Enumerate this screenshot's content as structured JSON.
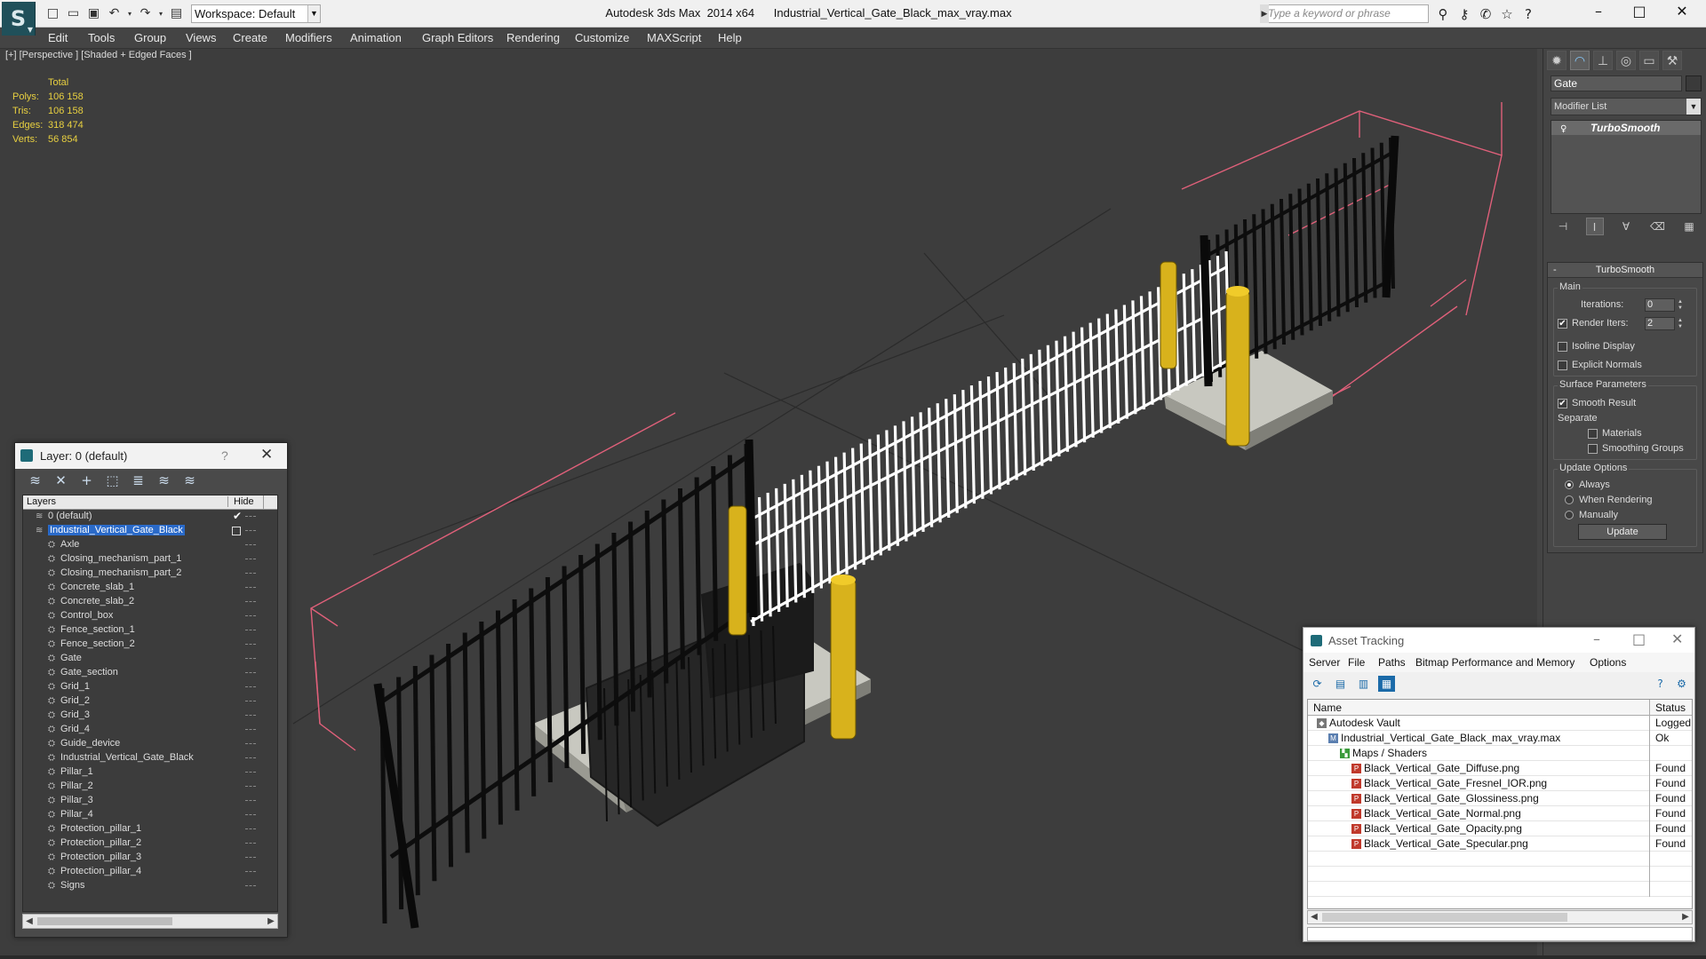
{
  "app": {
    "title": "Autodesk 3ds Max  2014 x64",
    "filename": "Industrial_Vertical_Gate_Black_max_vray.max",
    "workspace": "Workspace: Default",
    "search_placeholder": "Type a keyword or phrase"
  },
  "menu": [
    "Edit",
    "Tools",
    "Group",
    "Views",
    "Create",
    "Modifiers",
    "Animation",
    "Graph Editors",
    "Rendering",
    "Customize",
    "MAXScript",
    "Help"
  ],
  "viewport": {
    "label": "[+] [Perspective ] [Shaded + Edged Faces ]",
    "stats": {
      "header": "Total",
      "rows": [
        {
          "label": "Polys:",
          "value": "106 158"
        },
        {
          "label": "Tris:",
          "value": "106 158"
        },
        {
          "label": "Edges:",
          "value": "318 474"
        },
        {
          "label": "Verts:",
          "value": "56 854"
        }
      ]
    }
  },
  "layer_explorer": {
    "title": "Layer: 0 (default)",
    "help": "?",
    "columns": {
      "name": "Layers",
      "hide": "Hide"
    },
    "layers": [
      {
        "name": "0 (default)",
        "depth": 1,
        "kind": "layer",
        "active": true
      },
      {
        "name": "Industrial_Vertical_Gate_Black",
        "depth": 1,
        "kind": "layer",
        "selected": true
      },
      {
        "name": "Axle",
        "depth": 2,
        "kind": "object"
      },
      {
        "name": "Closing_mechanism_part_1",
        "depth": 2,
        "kind": "object"
      },
      {
        "name": "Closing_mechanism_part_2",
        "depth": 2,
        "kind": "object"
      },
      {
        "name": "Concrete_slab_1",
        "depth": 2,
        "kind": "object"
      },
      {
        "name": "Concrete_slab_2",
        "depth": 2,
        "kind": "object"
      },
      {
        "name": "Control_box",
        "depth": 2,
        "kind": "object"
      },
      {
        "name": "Fence_section_1",
        "depth": 2,
        "kind": "object"
      },
      {
        "name": "Fence_section_2",
        "depth": 2,
        "kind": "object"
      },
      {
        "name": "Gate",
        "depth": 2,
        "kind": "object"
      },
      {
        "name": "Gate_section",
        "depth": 2,
        "kind": "object"
      },
      {
        "name": "Grid_1",
        "depth": 2,
        "kind": "object"
      },
      {
        "name": "Grid_2",
        "depth": 2,
        "kind": "object"
      },
      {
        "name": "Grid_3",
        "depth": 2,
        "kind": "object"
      },
      {
        "name": "Grid_4",
        "depth": 2,
        "kind": "object"
      },
      {
        "name": "Guide_device",
        "depth": 2,
        "kind": "object"
      },
      {
        "name": "Industrial_Vertical_Gate_Black",
        "depth": 2,
        "kind": "object"
      },
      {
        "name": "Pillar_1",
        "depth": 2,
        "kind": "object"
      },
      {
        "name": "Pillar_2",
        "depth": 2,
        "kind": "object"
      },
      {
        "name": "Pillar_3",
        "depth": 2,
        "kind": "object"
      },
      {
        "name": "Pillar_4",
        "depth": 2,
        "kind": "object"
      },
      {
        "name": "Protection_pillar_1",
        "depth": 2,
        "kind": "object"
      },
      {
        "name": "Protection_pillar_2",
        "depth": 2,
        "kind": "object"
      },
      {
        "name": "Protection_pillar_3",
        "depth": 2,
        "kind": "object"
      },
      {
        "name": "Protection_pillar_4",
        "depth": 2,
        "kind": "object"
      },
      {
        "name": "Signs",
        "depth": 2,
        "kind": "object"
      }
    ]
  },
  "command_panel": {
    "object_name": "Gate",
    "modifier_list": "Modifier List",
    "stack_item": "TurboSmooth",
    "rollout_title": "TurboSmooth",
    "main_group": "Main",
    "iterations_label": "Iterations:",
    "iterations_value": "0",
    "render_iters_label": "Render Iters:",
    "render_iters_value": "2",
    "render_iters_checked": true,
    "isoline_label": "Isoline Display",
    "explicit_label": "Explicit Normals",
    "surface_group": "Surface Parameters",
    "smooth_label": "Smooth Result",
    "smooth_checked": true,
    "separate_label": "Separate",
    "materials_label": "Materials",
    "smoothing_groups_label": "Smoothing Groups",
    "update_group": "Update Options",
    "update_options": [
      "Always",
      "When Rendering",
      "Manually"
    ],
    "update_selected": "Always",
    "update_button": "Update"
  },
  "asset_tracking": {
    "title": "Asset Tracking",
    "menu": [
      "Server",
      "File",
      "Paths",
      "Bitmap Performance and Memory",
      "Options"
    ],
    "columns": {
      "name": "Name",
      "status": "Status"
    },
    "rows": [
      {
        "name": "Autodesk Vault",
        "depth": 1,
        "icon": "vault",
        "status": "Logged O"
      },
      {
        "name": "Industrial_Vertical_Gate_Black_max_vray.max",
        "depth": 2,
        "icon": "max",
        "status": "Ok"
      },
      {
        "name": "Maps / Shaders",
        "depth": 3,
        "icon": "maps",
        "status": ""
      },
      {
        "name": "Black_Vertical_Gate_Diffuse.png",
        "depth": 4,
        "icon": "png",
        "status": "Found"
      },
      {
        "name": "Black_Vertical_Gate_Fresnel_IOR.png",
        "depth": 4,
        "icon": "png",
        "status": "Found"
      },
      {
        "name": "Black_Vertical_Gate_Glossiness.png",
        "depth": 4,
        "icon": "png",
        "status": "Found"
      },
      {
        "name": "Black_Vertical_Gate_Normal.png",
        "depth": 4,
        "icon": "png",
        "status": "Found"
      },
      {
        "name": "Black_Vertical_Gate_Opacity.png",
        "depth": 4,
        "icon": "png",
        "status": "Found"
      },
      {
        "name": "Black_Vertical_Gate_Specular.png",
        "depth": 4,
        "icon": "png",
        "status": "Found"
      }
    ]
  },
  "colors": {
    "accent": "#2a6ac9",
    "stats_text": "#e8d040",
    "gate_selected": "#ffffff",
    "bounding_box": "#e0607a",
    "pillar_yellow": "#d8b21c"
  }
}
